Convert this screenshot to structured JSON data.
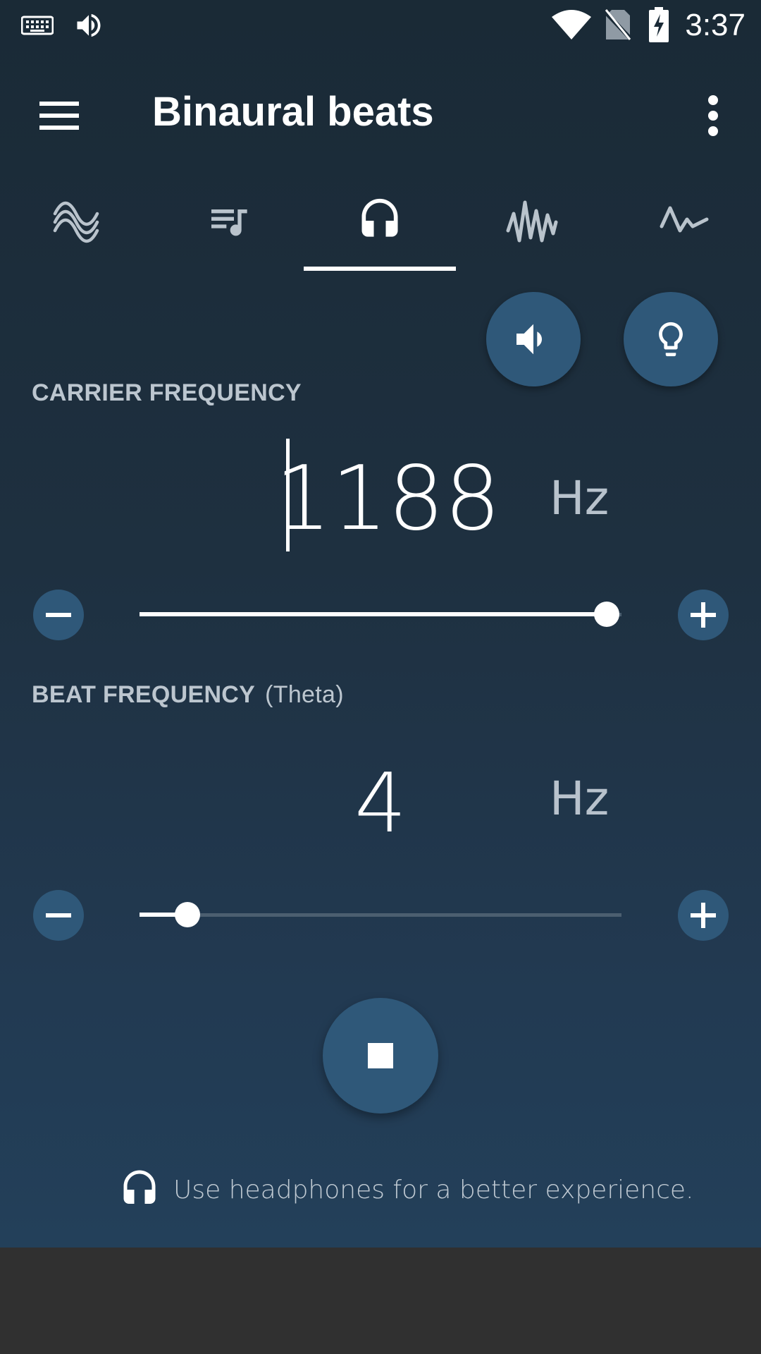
{
  "status_bar": {
    "time": "3:37",
    "icons": [
      "keyboard-icon",
      "volume-icon",
      "wifi-icon",
      "no-sim-icon",
      "battery-charging-icon"
    ]
  },
  "app_bar": {
    "title": "Binaural beats",
    "menu_icon": "hamburger-menu-icon",
    "more_icon": "more-vertical-icon"
  },
  "tabs": [
    {
      "icon": "wave-icon",
      "selected": false
    },
    {
      "icon": "playlist-icon",
      "selected": false
    },
    {
      "icon": "headphones-icon",
      "selected": true
    },
    {
      "icon": "noise-icon",
      "selected": false
    },
    {
      "icon": "pulse-icon",
      "selected": false
    }
  ],
  "actions": {
    "volume_icon": "volume-icon",
    "light_icon": "lightbulb-icon"
  },
  "carrier": {
    "label": "CARRIER FREQUENCY",
    "value": "1188",
    "unit": "Hz",
    "slider_fraction": 0.97
  },
  "beat": {
    "label": "BEAT FREQUENCY",
    "sub_label": "(Theta)",
    "value": "4",
    "unit": "Hz",
    "slider_fraction": 0.1
  },
  "controls": {
    "stop_icon": "stop-icon"
  },
  "hint": {
    "icon": "headphones-icon",
    "text": "Use headphones for a better experience."
  },
  "colors": {
    "accent": "#2f5879",
    "background_top": "#1a2a36",
    "background_bottom": "#23405a"
  }
}
